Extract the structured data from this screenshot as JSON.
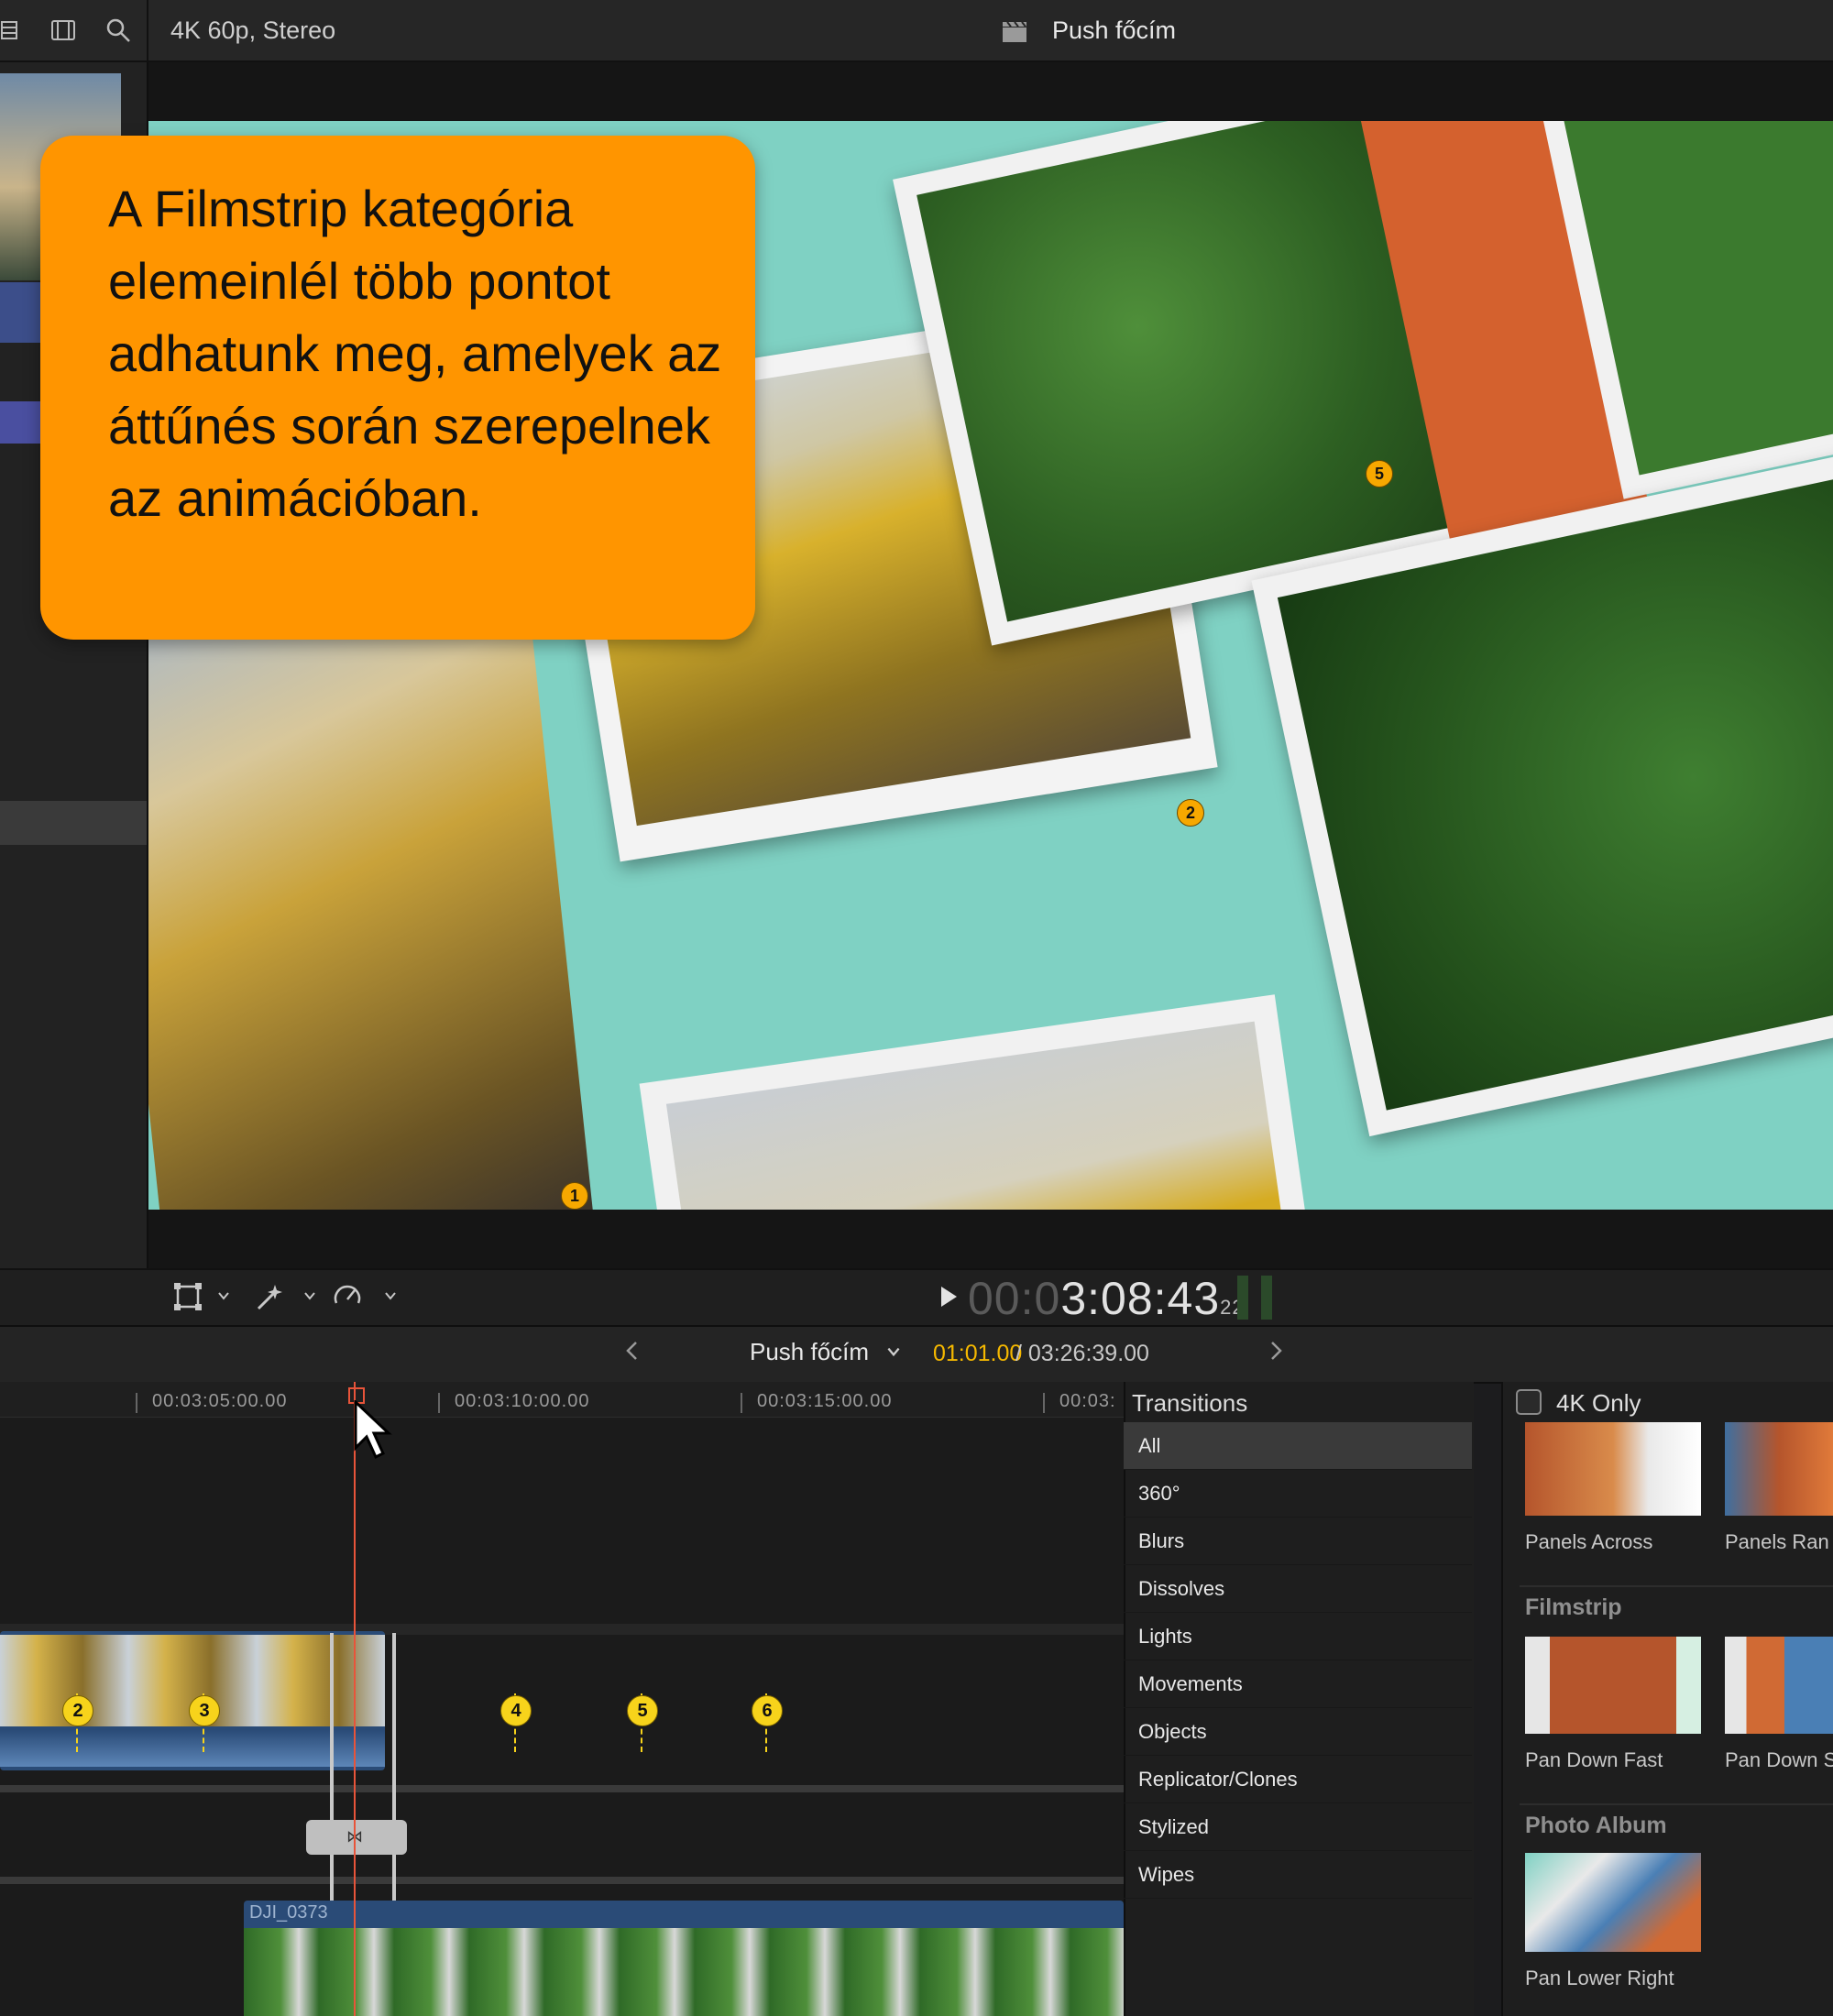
{
  "toolbar": {
    "format": "4K 60p, Stereo",
    "viewer_title": "Push főcím"
  },
  "callout": {
    "text": "A Filmstrip kategória elemeinlél több pontot adhatunk meg, amelyek az áttűnés során szerepelnek az animációban."
  },
  "viewer": {
    "marker_labels": [
      "1",
      "2",
      "5"
    ]
  },
  "playback": {
    "timecode_dim": "00:0",
    "timecode_main": "3:08:43",
    "timecode_frames": "22"
  },
  "timeline": {
    "project": "Push főcím",
    "position": "01:01.00",
    "duration": "/ 03:26:39.00",
    "ruler": [
      "00:03:05:00.00",
      "00:03:10:00.00",
      "00:03:15:00.00",
      "00:03:"
    ],
    "markers": [
      "2",
      "3",
      "4",
      "5",
      "6"
    ],
    "clip_name": "DJI_0373"
  },
  "transitions": {
    "title": "Transitions",
    "categories": [
      "All",
      "360°",
      "Blurs",
      "Dissolves",
      "Lights",
      "Movements",
      "Objects",
      "Replicator/Clones",
      "Stylized",
      "Wipes"
    ],
    "selected": "All"
  },
  "browser": {
    "filter_label": "4K Only",
    "items_top": [
      "Panels Across",
      "Panels Ran"
    ],
    "group_filmstrip": "Filmstrip",
    "items_filmstrip": [
      "Pan Down Fast",
      "Pan Down S"
    ],
    "group_photo": "Photo Album",
    "items_photo": [
      "Pan Lower Right"
    ]
  },
  "colors": {
    "accent": "#f5b800",
    "callout": "#ff9500",
    "playhead": "#e8543a",
    "marker": "#f7d31b"
  }
}
